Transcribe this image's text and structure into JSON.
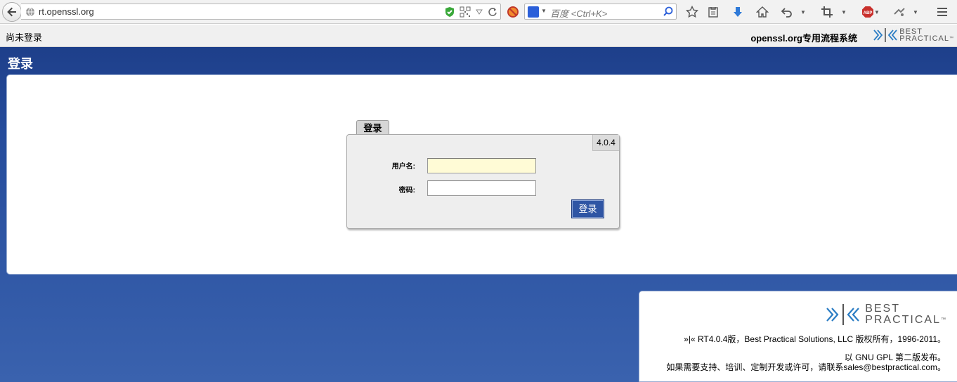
{
  "browser": {
    "url": "rt.openssl.org",
    "search_placeholder": "百度 <Ctrl+K>"
  },
  "header": {
    "login_status": "尚未登录",
    "system_name": "openssl.org专用流程系统",
    "logo_line1": "BEST",
    "logo_line2": "PRACTICAL",
    "logo_tm": "™"
  },
  "page": {
    "title": "登录"
  },
  "login": {
    "tab_label": "登录",
    "version": "4.0.4",
    "username_label": "用户名:",
    "username_value": "",
    "password_label": "密码:",
    "password_value": "",
    "submit_label": "登录"
  },
  "footer": {
    "logo_line1": "BEST",
    "logo_line2": "PRACTICAL",
    "logo_tm": "™",
    "copyright": "»|« RT4.0.4版，Best Practical Solutions, LLC 版权所有，1996-2011。",
    "license": "以 GNU GPL 第二版发布。",
    "contact": "如果需要支持、培训、定制开发或许可，请联系sales@bestpractical.com。"
  },
  "colors": {
    "brand_blue": "#2f55a4",
    "header_blue": "#1e3f8a",
    "logo_blue": "#2b7dc4"
  }
}
